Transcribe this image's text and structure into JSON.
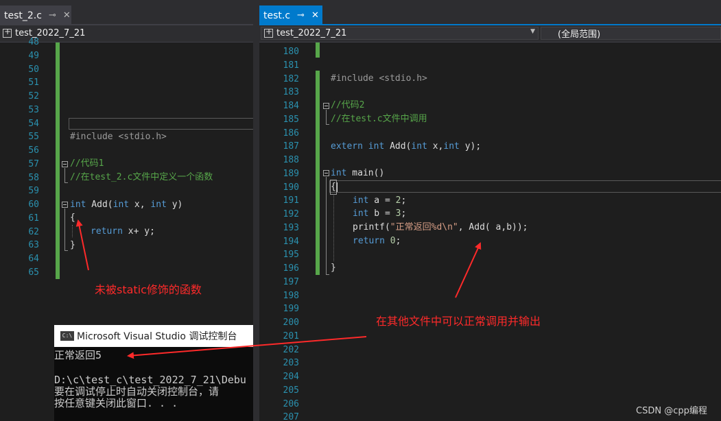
{
  "left": {
    "tab_label": "test_2.c",
    "nav_project": "test_2022_7_21",
    "line_numbers": [
      "48",
      "49",
      "50",
      "51",
      "52",
      "53",
      "54",
      "55",
      "56",
      "57",
      "58",
      "59",
      "60",
      "61",
      "62",
      "63",
      "64",
      "65"
    ],
    "code": {
      "l55_include": "#include <stdio.h>",
      "l57_comment": "//代码1",
      "l58_comment": "//在test_2.c文件中定义一个函数",
      "l60_kw1": "int",
      "l60_name": " Add(",
      "l60_kw2": "int",
      "l60_mid": " x, ",
      "l60_kw3": "int",
      "l60_end": " y)",
      "l61_brace": "{",
      "l62_kw": "return",
      "l62_rest": " x+ y;",
      "l63_brace": "}"
    }
  },
  "right": {
    "tab_label": "test.c",
    "nav_project": "test_2022_7_21",
    "nav_scope": "(全局范围)",
    "line_numbers": [
      "180",
      "181",
      "182",
      "183",
      "184",
      "185",
      "186",
      "187",
      "188",
      "189",
      "190",
      "191",
      "192",
      "193",
      "194",
      "195",
      "196",
      "197",
      "198",
      "199",
      "200",
      "201",
      "202",
      "203",
      "204",
      "205",
      "206",
      "207"
    ],
    "code": {
      "l182_include": "#include <stdio.h>",
      "l184_comment": "//代码2",
      "l185_comment": "//在test.c文件中调用",
      "l187_kw1": "extern",
      "l187_kw2": "int",
      "l187_name": " Add(",
      "l187_kw3": "int",
      "l187_mid": " x,",
      "l187_kw4": "int",
      "l187_end": " y);",
      "l189_kw": "int",
      "l189_rest": " main()",
      "l190_brace": "{",
      "l191_kw": "int",
      "l191_a": " a = ",
      "l191_num": "2",
      "l191_semi": ";",
      "l192_kw": "int",
      "l192_b": " b = ",
      "l192_num": "3",
      "l192_semi": ";",
      "l193_func": "printf(",
      "l193_str": "\"正常返回%d\\n\"",
      "l193_rest": ", Add( a,b));",
      "l194_kw": "return",
      "l194_num": " 0",
      "l194_semi": ";",
      "l196_brace": "}"
    }
  },
  "console": {
    "title": "Microsoft Visual Studio 调试控制台",
    "icon_text": "C:\\",
    "lines": [
      "正常返回5",
      "",
      "D:\\c\\test_c\\test_2022_7_21\\Debu",
      "要在调试停止时自动关闭控制台，请",
      "按任意键关闭此窗口. . ."
    ]
  },
  "annotations": {
    "left_note": "未被static修饰的函数",
    "right_note": "在其他文件中可以正常调用并输出"
  },
  "watermark": "CSDN @cpp编程",
  "colors": {
    "keyword": "#569cd6",
    "comment": "#57a64a",
    "line_number": "#2b91af",
    "annotation": "#ff2a2a",
    "active_tab": "#007acc"
  }
}
